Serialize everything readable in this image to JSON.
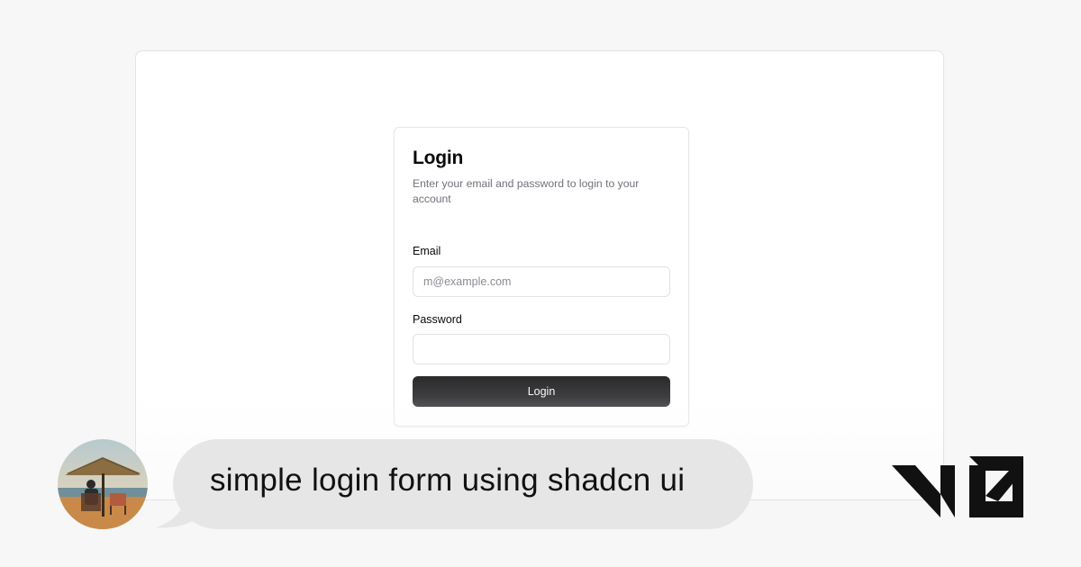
{
  "login": {
    "title": "Login",
    "description": "Enter your email and password to login to your account",
    "email_label": "Email",
    "email_placeholder": "m@example.com",
    "email_value": "",
    "password_label": "Password",
    "password_value": "",
    "submit_label": "Login"
  },
  "chat": {
    "prompt": "simple login form using shadcn ui"
  },
  "colors": {
    "page_bg": "#f7f7f7",
    "button_bg": "#2a2a2c",
    "bubble_bg": "#e6e6e6",
    "muted_text": "#71717a"
  }
}
